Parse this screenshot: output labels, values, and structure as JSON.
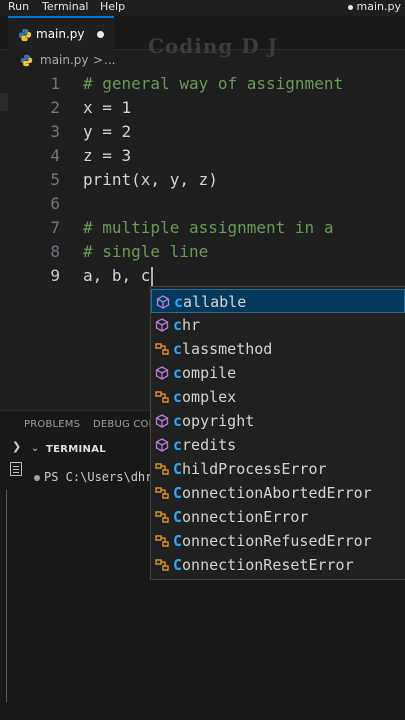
{
  "menu": {
    "items": [
      "Run",
      "Terminal",
      "Help"
    ],
    "right_tab": "main.py"
  },
  "watermark": "Coding D J",
  "tab": {
    "label": "main.py"
  },
  "breadcrumb": {
    "file": "main.py",
    "separator": ">",
    "more": "..."
  },
  "editor": {
    "lines": [
      {
        "num": "1",
        "text": "# general way of assignment",
        "type": "comment"
      },
      {
        "num": "2",
        "text": "x = 1",
        "type": "code"
      },
      {
        "num": "3",
        "text": "y = 2",
        "type": "code"
      },
      {
        "num": "4",
        "text": "z = 3",
        "type": "code"
      },
      {
        "num": "5",
        "text": "print(x, y, z)",
        "type": "code"
      },
      {
        "num": "6",
        "text": "",
        "type": "code"
      },
      {
        "num": "7",
        "text": "# multiple assignment in a",
        "type": "comment"
      },
      {
        "num": "8",
        "text": "# single line",
        "type": "comment"
      },
      {
        "num": "9",
        "text": "a, b, c",
        "type": "code",
        "active": true
      }
    ]
  },
  "panel": {
    "tabs": [
      "PROBLEMS",
      "DEBUG CONS"
    ],
    "terminal_title": "TERMINAL",
    "terminal_line": "PS C:\\Users\\dhruv"
  },
  "suggestions": {
    "typed_prefix": "c",
    "items": [
      {
        "prefix": "c",
        "rest": "allable",
        "icon": "cube-icon",
        "selected": true
      },
      {
        "prefix": "c",
        "rest": "hr",
        "icon": "cube-icon"
      },
      {
        "prefix": "c",
        "rest": "lassmethod",
        "icon": "class-icon"
      },
      {
        "prefix": "c",
        "rest": "ompile",
        "icon": "cube-icon"
      },
      {
        "prefix": "c",
        "rest": "omplex",
        "icon": "class-icon"
      },
      {
        "prefix": "c",
        "rest": "opyright",
        "icon": "cube-icon"
      },
      {
        "prefix": "c",
        "rest": "redits",
        "icon": "cube-icon"
      },
      {
        "prefix": "C",
        "rest": "hildProcessError",
        "icon": "class-icon"
      },
      {
        "prefix": "C",
        "rest": "onnectionAbortedError",
        "icon": "class-icon"
      },
      {
        "prefix": "C",
        "rest": "onnectionError",
        "icon": "class-icon"
      },
      {
        "prefix": "C",
        "rest": "onnectionRefusedError",
        "icon": "class-icon"
      },
      {
        "prefix": "C",
        "rest": "onnectionResetError",
        "icon": "class-icon"
      }
    ]
  },
  "colors": {
    "comment": "#6a9955",
    "code": "#d4d4d4",
    "match_highlight": "#2aaaff",
    "cube_icon": "#b180d7",
    "class_icon": "#ee9d28",
    "tab_accent": "#0078d4"
  }
}
